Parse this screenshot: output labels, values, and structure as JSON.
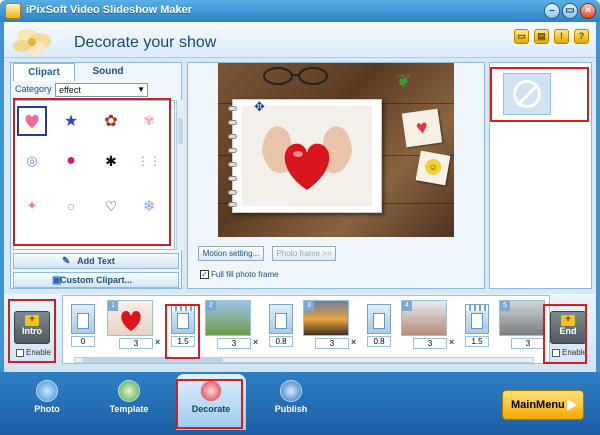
{
  "window": {
    "title": "iPixSoft Video Slideshow Maker"
  },
  "header": {
    "title": "Decorate your show"
  },
  "left_panel": {
    "tabs": [
      {
        "label": "Clipart"
      },
      {
        "label": "Sound"
      }
    ],
    "category_label": "Category",
    "category_value": "effect",
    "add_text_label": "Add Text",
    "custom_clipart_label": "Custom Clipart...",
    "clipart_items": [
      "pink-heart",
      "blue-stars",
      "butterfly",
      "flowers",
      "rings",
      "lips",
      "ant",
      "pink-drops",
      "pink-sparkle",
      "bubbles",
      "black-heart",
      "snowflake"
    ]
  },
  "preview": {
    "motion_setting_label": "Motion setting...",
    "photo_frame_label": "Photo frame >>",
    "full_fill_label": "Full fill photo frame",
    "full_fill_checked": true
  },
  "storyboard": {
    "intro_label": "Intro",
    "end_label": "End",
    "enable_label": "Enable",
    "transitions": [
      {
        "duration": "0"
      },
      {
        "duration": "1.5"
      },
      {
        "duration": "0.8"
      },
      {
        "duration": "0.8"
      },
      {
        "duration": "1.5"
      }
    ],
    "slides": [
      {
        "number": "1",
        "duration": "3"
      },
      {
        "number": "2",
        "duration": "3"
      },
      {
        "number": "3",
        "duration": "3"
      },
      {
        "number": "4",
        "duration": "3"
      },
      {
        "number": "5",
        "duration": "3"
      }
    ]
  },
  "bottom_nav": {
    "items": [
      {
        "label": "Photo"
      },
      {
        "label": "Template"
      },
      {
        "label": "Decorate"
      },
      {
        "label": "Publish"
      }
    ],
    "main_menu_label": "MainMenu"
  }
}
